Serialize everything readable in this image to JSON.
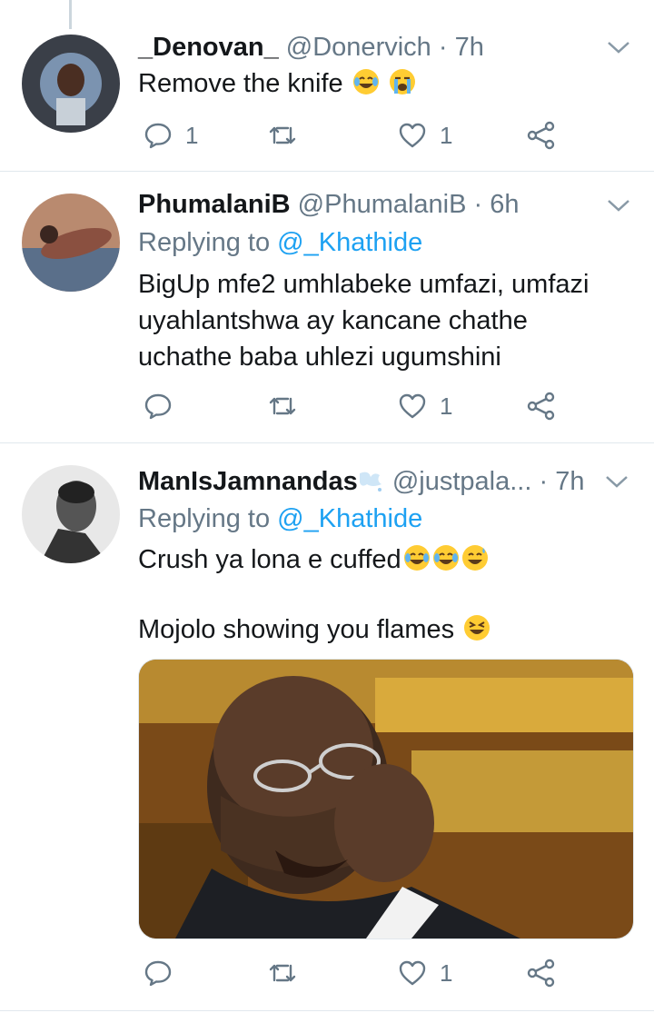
{
  "tweets": [
    {
      "display_name": "_Denovan_",
      "handle": "@Donervich",
      "separator": "·",
      "time": "7h",
      "text": "Remove the knife",
      "emojis": [
        "face-with-tears-of-joy",
        "loudly-crying-face"
      ],
      "counts": {
        "replies": "1",
        "retweets": "",
        "likes": "1"
      }
    },
    {
      "display_name": "PhumalaniB",
      "handle": "@PhumalaniB",
      "separator": "·",
      "time": "6h",
      "replying_prefix": "Replying to",
      "replying_mention": "@_Khathide",
      "text_lines": [
        "BigUp mfe2 umhlabeke umfazi, umfazi",
        "uyahlantshwa ay kancane chathe",
        "uchathe baba uhlezi ugumshini"
      ],
      "counts": {
        "replies": "",
        "retweets": "",
        "likes": "1"
      }
    },
    {
      "display_name": "ManIsJamnandas",
      "handle": "@justpala...",
      "separator": "·",
      "time": "7h",
      "replying_prefix": "Replying to",
      "replying_mention": "@_Khathide",
      "text_line1": "Crush ya lona e cuffed",
      "text_line2": "Mojolo showing you flames",
      "emojis_line1": [
        "face-with-tears-of-joy",
        "face-with-tears-of-joy",
        "grinning-face-with-sweat"
      ],
      "emojis_line2": [
        "grinning-squinting-face"
      ],
      "name_emoji": "dashing-away",
      "counts": {
        "replies": "",
        "retweets": "",
        "likes": "1"
      }
    }
  ],
  "colors": {
    "accent": "#1da1f2",
    "muted": "#657786",
    "text": "#14171a",
    "divider": "#e1e8ed"
  },
  "icons": [
    "reply-icon",
    "retweet-icon",
    "like-icon",
    "share-icon",
    "caret-down-icon"
  ]
}
